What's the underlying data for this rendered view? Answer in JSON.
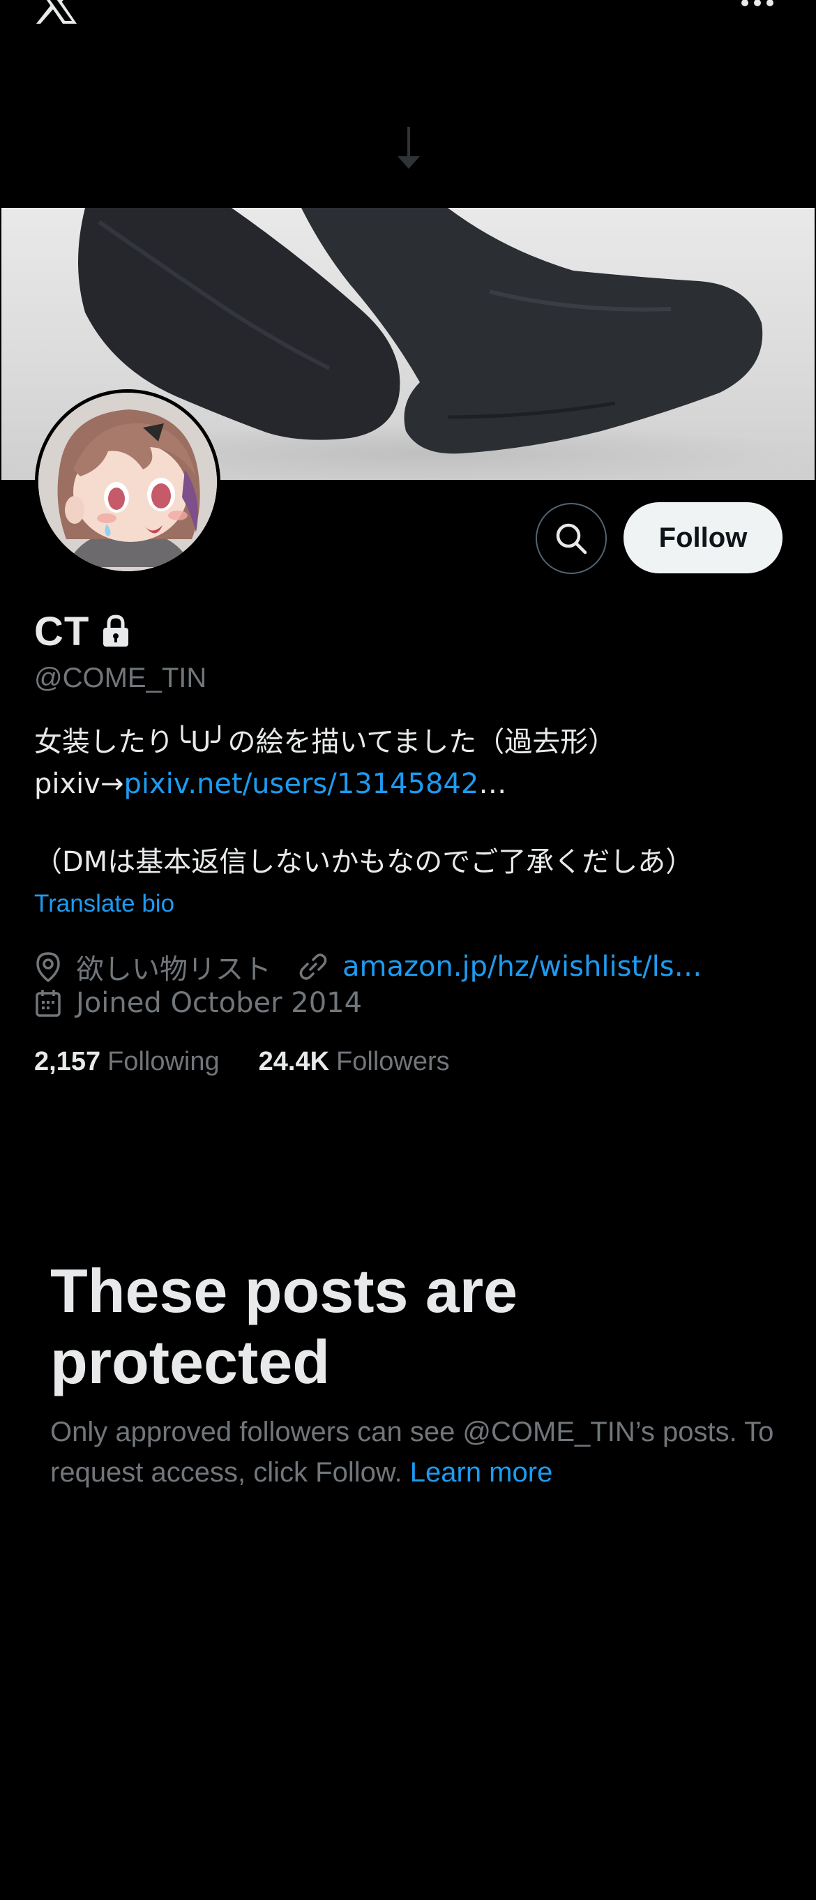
{
  "header": {
    "logo_icon": "x-logo-icon",
    "more_icon": "more-dots-icon"
  },
  "profile": {
    "banner_description": "banner-image",
    "avatar": "avatar-image",
    "display_name": "CT",
    "protected_icon": "lock-icon",
    "handle": "@COME_TIN",
    "actions": {
      "search_icon": "search-icon",
      "follow_label": "Follow"
    },
    "bio": {
      "line1": "女装したり╰U╯の絵を描いてました（過去形）",
      "line2_prefix": "pixiv→",
      "line2_link": "pixiv.net/users/13145842",
      "line2_suffix": "…",
      "line3": "（DMは基本返信しないかもなのでご了承くだしあ）"
    },
    "translate_label": "Translate bio",
    "location": "欲しい物リスト",
    "website": "amazon.jp/hz/wishlist/ls…",
    "joined": "Joined October 2014",
    "stats": {
      "following_count": "2,157",
      "following_label": "Following",
      "followers_count": "24.4K",
      "followers_label": "Followers"
    }
  },
  "protected_notice": {
    "title": "These posts are protected",
    "description": "Only approved followers can see @COME_TIN’s posts. To request access, click Follow.",
    "learn_more": "Learn more"
  },
  "colors": {
    "background": "#000000",
    "text_primary": "#e7e9ea",
    "text_secondary": "#71767b",
    "link": "#1d9bf0",
    "follow_button_bg": "#eff3f4"
  }
}
